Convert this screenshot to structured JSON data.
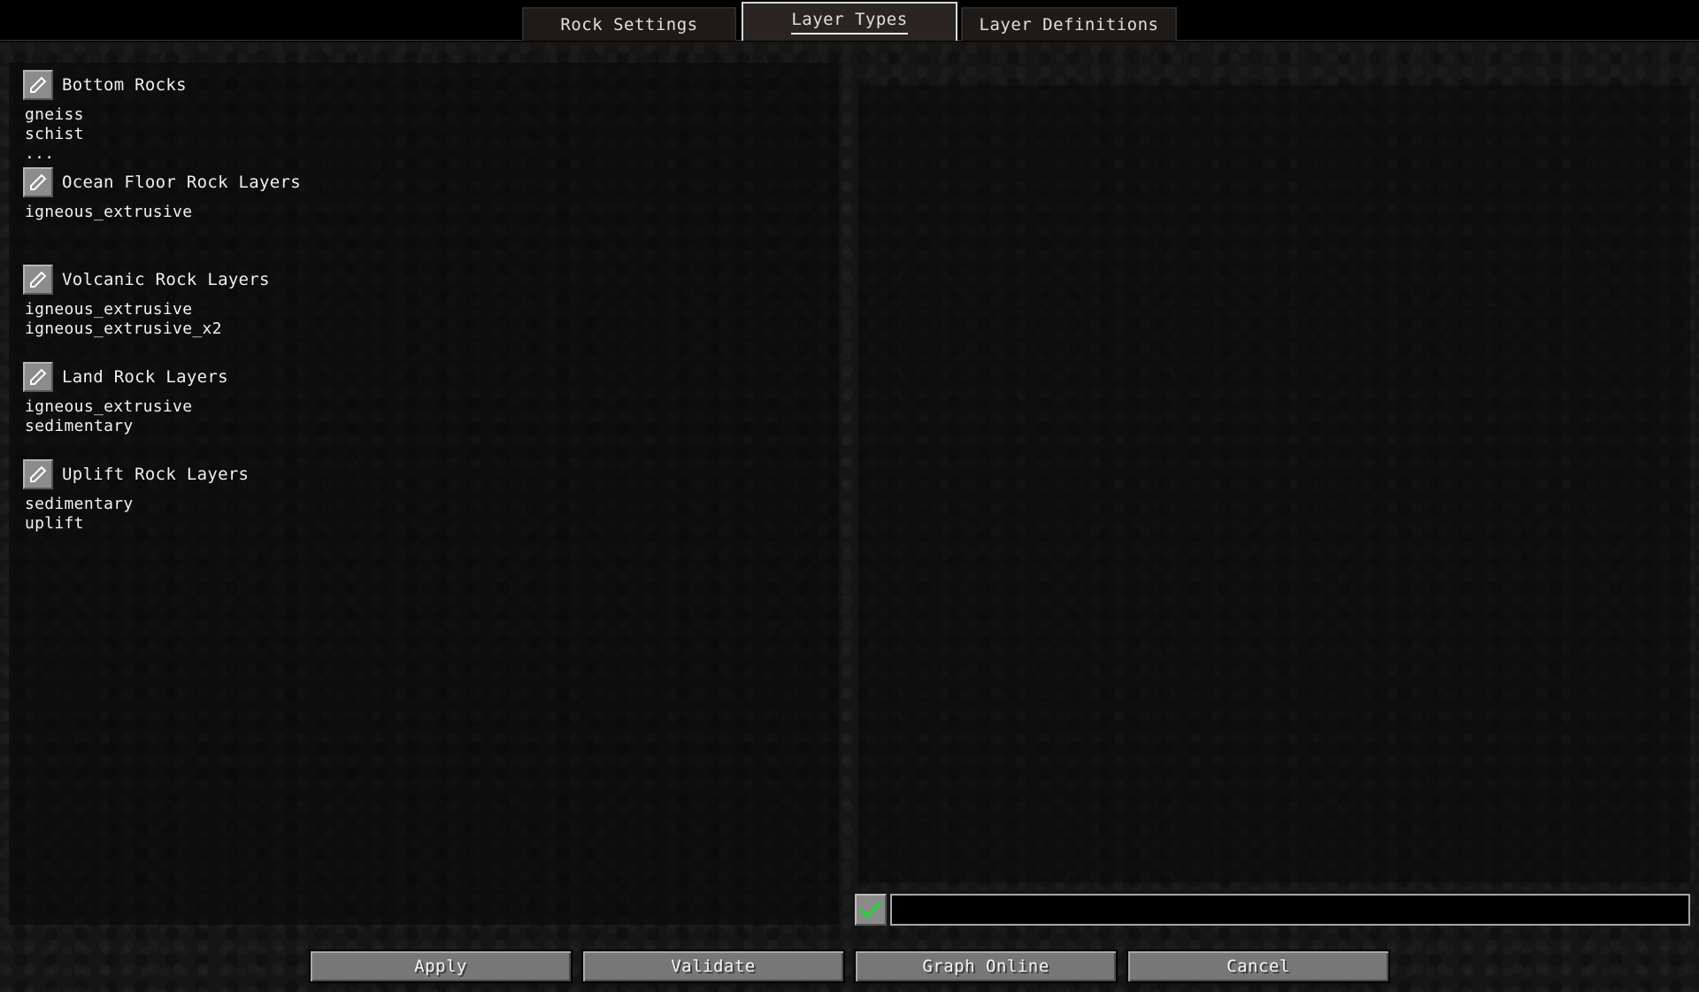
{
  "tabs": [
    {
      "label": "Rock Settings",
      "active": false
    },
    {
      "label": "Layer Types",
      "active": true
    },
    {
      "label": "Layer Definitions",
      "active": false
    }
  ],
  "layer_groups": [
    {
      "title": "Bottom Rocks",
      "items": [
        "gneiss",
        "schist",
        "..."
      ]
    },
    {
      "title": "Ocean Floor Rock Layers",
      "items": [
        "igneous_extrusive"
      ]
    },
    {
      "title": "Volcanic Rock Layers",
      "items": [
        "igneous_extrusive",
        "igneous_extrusive_x2"
      ]
    },
    {
      "title": "Land Rock Layers",
      "items": [
        "igneous_extrusive",
        "sedimentary"
      ]
    },
    {
      "title": "Uplift Rock Layers",
      "items": [
        "sedimentary",
        "uplift"
      ]
    }
  ],
  "editor": {
    "input_value": "",
    "confirm_icon": "checkmark-icon",
    "confirm_color": "#2ecc40"
  },
  "buttons": {
    "apply": "Apply",
    "validate": "Validate",
    "graph_online": "Graph Online",
    "cancel": "Cancel"
  },
  "icons": {
    "edit": "pencil-icon"
  }
}
